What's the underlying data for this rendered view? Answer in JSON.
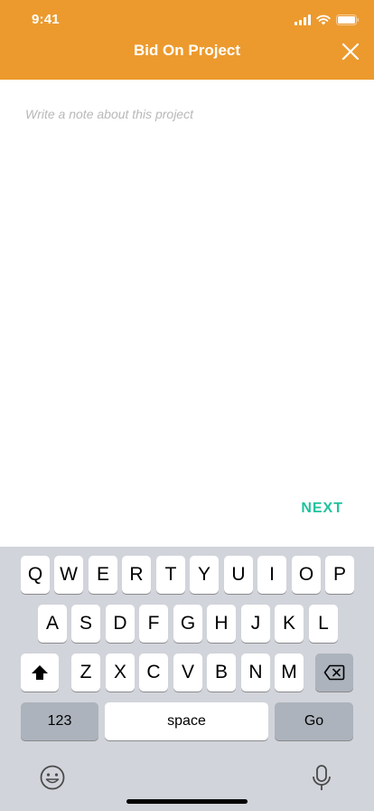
{
  "status": {
    "time": "9:41"
  },
  "header": {
    "title": "Bid On Project"
  },
  "note": {
    "placeholder": "Write a note about this project",
    "value": ""
  },
  "actions": {
    "next_label": "NEXT"
  },
  "keyboard": {
    "row1": [
      "Q",
      "W",
      "E",
      "R",
      "T",
      "Y",
      "U",
      "I",
      "O",
      "P"
    ],
    "row2": [
      "A",
      "S",
      "D",
      "F",
      "G",
      "H",
      "J",
      "K",
      "L"
    ],
    "row3": [
      "Z",
      "X",
      "C",
      "V",
      "B",
      "N",
      "M"
    ],
    "numbers_label": "123",
    "space_label": "space",
    "go_label": "Go"
  },
  "colors": {
    "header_bg": "#EC9A2E",
    "next": "#21C29E",
    "keyboard_bg": "#D1D4DA"
  },
  "icons": [
    "signal-icon",
    "wifi-icon",
    "battery-icon",
    "close-icon",
    "shift-icon",
    "backspace-icon",
    "emoji-icon",
    "microphone-icon"
  ]
}
